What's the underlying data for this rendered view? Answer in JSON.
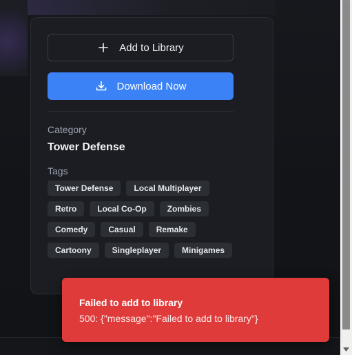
{
  "actions": {
    "add_to_library_label": "Add to Library",
    "download_label": "Download Now"
  },
  "details": {
    "category_label": "Category",
    "category_value": "Tower Defense",
    "tags_label": "Tags",
    "tags": [
      "Tower Defense",
      "Local Multiplayer",
      "Retro",
      "Local Co-Op",
      "Zombies",
      "Comedy",
      "Casual",
      "Remake",
      "Cartoony",
      "Singleplayer",
      "Minigames"
    ]
  },
  "toast": {
    "title": "Failed to add to library",
    "message": "500: {\"message\":\"Failed to add to library\"}"
  },
  "colors": {
    "accent": "#3b82f6",
    "error": "#e03b3b",
    "card": "#1b1d22",
    "tag": "#2b2e35"
  },
  "icons": {
    "add": "plus-icon",
    "download": "download-icon"
  }
}
